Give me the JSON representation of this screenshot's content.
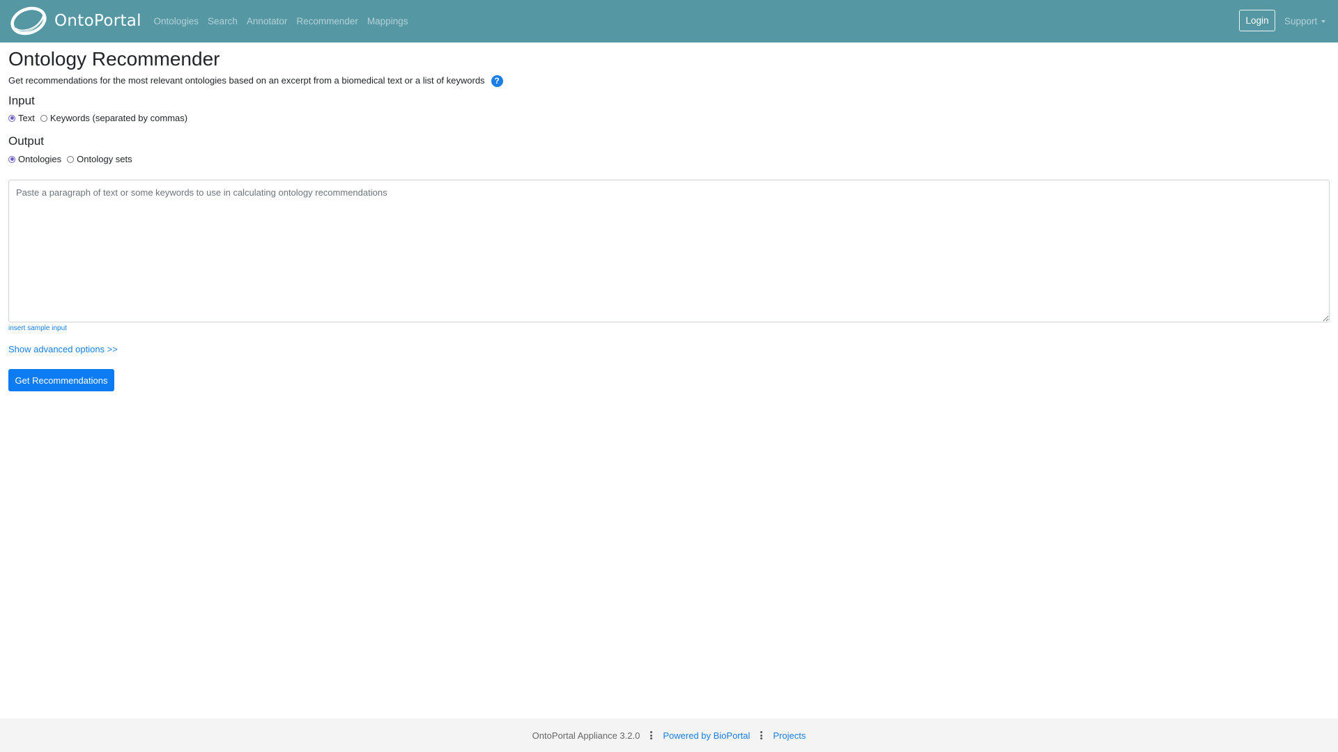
{
  "navbar": {
    "brand": "OntoPortal",
    "links": [
      "Ontologies",
      "Search",
      "Annotator",
      "Recommender",
      "Mappings"
    ],
    "login": "Login",
    "support": "Support",
    "color": "#5598a4"
  },
  "page": {
    "title": "Ontology Recommender",
    "description": "Get recommendations for the most relevant ontologies based on an excerpt from a biomedical text or a list of keywords",
    "help_icon": "?"
  },
  "input": {
    "heading": "Input",
    "options": [
      {
        "label": "Text",
        "checked": true
      },
      {
        "label": "Keywords (separated by commas)",
        "checked": false
      }
    ]
  },
  "output": {
    "heading": "Output",
    "options": [
      {
        "label": "Ontologies",
        "checked": true
      },
      {
        "label": "Ontology sets",
        "checked": false
      }
    ]
  },
  "textarea": {
    "value": "",
    "placeholder": "Paste a paragraph of text or some keywords to use in calculating ontology recommendations"
  },
  "links": {
    "sample": "insert sample input",
    "advanced": "Show advanced options >>"
  },
  "submit_label": "Get Recommendations",
  "footer": {
    "version": "OntoPortal Appliance 3.2.0",
    "powered": "Powered by BioPortal",
    "projects": "Projects"
  }
}
